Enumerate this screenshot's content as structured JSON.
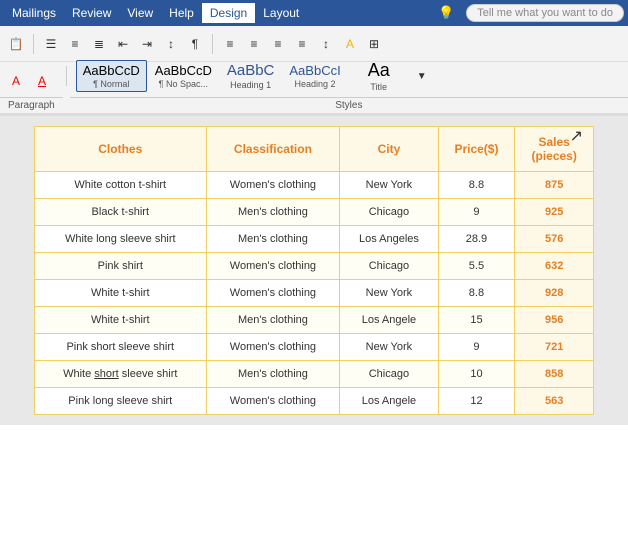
{
  "menu": {
    "items": [
      "Mailings",
      "Review",
      "View",
      "Help",
      "Design",
      "Layout"
    ],
    "active": "Design",
    "tell_me": "Tell me what you want to do"
  },
  "toolbar": {
    "paragraph_label": "Paragraph",
    "styles_label": "Styles"
  },
  "styles": [
    {
      "id": "normal",
      "preview": "AaBbCcD",
      "label": "¶ Normal",
      "selected": true
    },
    {
      "id": "nospace",
      "preview": "AaBbCcD",
      "label": "¶ No Spac..."
    },
    {
      "id": "h1",
      "preview": "AaBbC",
      "label": "Heading 1"
    },
    {
      "id": "h2",
      "preview": "AaBbCc",
      "label": "Heading 2"
    },
    {
      "id": "title",
      "preview": "Aa",
      "label": "Title"
    }
  ],
  "table": {
    "headers": [
      "Clothes",
      "Classification",
      "City",
      "Price($)",
      "Sales\n(pieces)"
    ],
    "rows": [
      [
        "White cotton t-shirt",
        "Women's clothing",
        "New York",
        "8.8",
        "875"
      ],
      [
        "Black t-shirt",
        "Men's clothing",
        "Chicago",
        "9",
        "925"
      ],
      [
        "White long sleeve shirt",
        "Men's clothing",
        "Los Angeles",
        "28.9",
        "576"
      ],
      [
        "Pink shirt",
        "Women's clothing",
        "Chicago",
        "5.5",
        "632"
      ],
      [
        "White t-shirt",
        "Women's clothing",
        "New York",
        "8.8",
        "928"
      ],
      [
        "White t-shirt",
        "Men's clothing",
        "Los Angele",
        "15",
        "956"
      ],
      [
        "Pink short sleeve shirt",
        "Women's clothing",
        "New York",
        "9",
        "721"
      ],
      [
        "White short sleeve shirt",
        "Men's clothing",
        "Chicago",
        "10",
        "858"
      ],
      [
        "Pink long sleeve shirt",
        "Women's clothing",
        "Los Angele",
        "12",
        "563"
      ]
    ]
  }
}
